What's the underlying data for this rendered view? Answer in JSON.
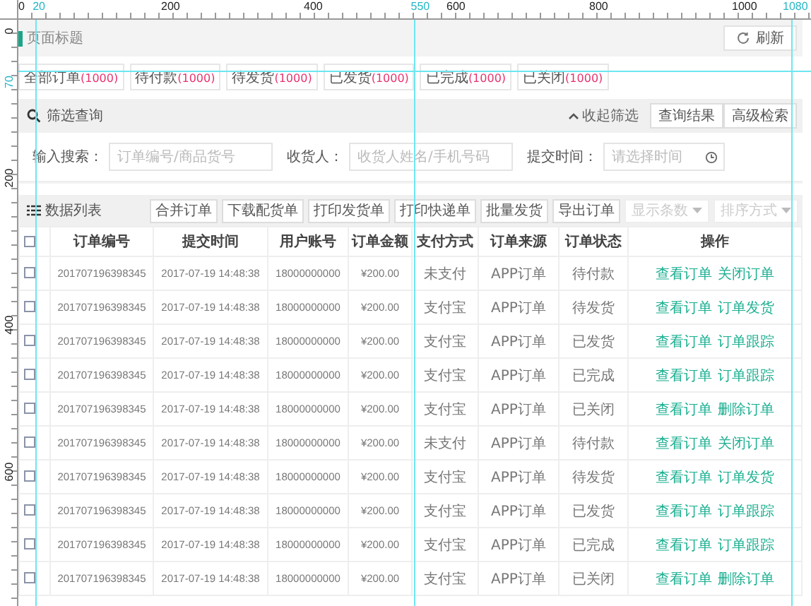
{
  "ruler": {
    "top": [
      {
        "label": "0",
        "kind": "tick"
      },
      {
        "label": "20",
        "kind": "guide"
      },
      {
        "label": "200",
        "kind": "tick"
      },
      {
        "label": "400",
        "kind": "tick"
      },
      {
        "label": "550",
        "kind": "guide"
      },
      {
        "label": "600",
        "kind": "tick"
      },
      {
        "label": "800",
        "kind": "tick"
      },
      {
        "label": "1000",
        "kind": "tick"
      },
      {
        "label": "1080",
        "kind": "guide"
      }
    ],
    "left": [
      {
        "label": "0",
        "kind": "tick"
      },
      {
        "label": "70",
        "kind": "guide"
      },
      {
        "label": "200",
        "kind": "tick"
      },
      {
        "label": "400",
        "kind": "tick"
      },
      {
        "label": "600",
        "kind": "tick"
      }
    ]
  },
  "page_header": {
    "title": "页面标题",
    "refresh_button": "刷新"
  },
  "tabs": [
    {
      "label": "全部订单",
      "count": "(1000)"
    },
    {
      "label": "待付款",
      "count": "(1000)"
    },
    {
      "label": "待发货",
      "count": "(1000)"
    },
    {
      "label": "已发货",
      "count": "(1000)"
    },
    {
      "label": "已完成",
      "count": "(1000)"
    },
    {
      "label": "已关闭",
      "count": "(1000)"
    }
  ],
  "filter": {
    "title": "筛选查询",
    "collapse": "收起筛选",
    "buttons": [
      "查询结果",
      "高级检索"
    ],
    "fields": [
      {
        "label": "输入搜索：",
        "placeholder": "订单编号/商品货号",
        "kind": "text"
      },
      {
        "label": "收货人：",
        "placeholder": "收货人姓名/手机号码",
        "kind": "text"
      },
      {
        "label": "提交时间：",
        "placeholder": "请选择时间",
        "kind": "date"
      }
    ]
  },
  "list": {
    "title": "数据列表",
    "buttons": [
      "合并订单",
      "下载配货单",
      "打印发货单",
      "打印快递单",
      "批量发货",
      "导出订单"
    ],
    "selects": [
      {
        "placeholder": "显示条数"
      },
      {
        "placeholder": "排序方式"
      }
    ]
  },
  "table": {
    "header_checked": false,
    "columns": [
      "订单编号",
      "提交时间",
      "用户账号",
      "订单金额",
      "支付方式",
      "订单来源",
      "订单状态",
      "操作"
    ],
    "rows": [
      {
        "checked": false,
        "cells": [
          "201707196398345",
          "2017-07-19 14:48:38",
          "18000000000",
          "¥200.00",
          "未支付",
          "APP订单",
          "待付款"
        ],
        "actions": [
          "查看订单",
          "关闭订单"
        ]
      },
      {
        "checked": false,
        "cells": [
          "201707196398345",
          "2017-07-19 14:48:38",
          "18000000000",
          "¥200.00",
          "支付宝",
          "APP订单",
          "待发货"
        ],
        "actions": [
          "查看订单",
          "订单发货"
        ]
      },
      {
        "checked": false,
        "cells": [
          "201707196398345",
          "2017-07-19 14:48:38",
          "18000000000",
          "¥200.00",
          "支付宝",
          "APP订单",
          "已发货"
        ],
        "actions": [
          "查看订单",
          "订单跟踪"
        ]
      },
      {
        "checked": false,
        "cells": [
          "201707196398345",
          "2017-07-19 14:48:38",
          "18000000000",
          "¥200.00",
          "支付宝",
          "APP订单",
          "已完成"
        ],
        "actions": [
          "查看订单",
          "订单跟踪"
        ]
      },
      {
        "checked": false,
        "cells": [
          "201707196398345",
          "2017-07-19 14:48:38",
          "18000000000",
          "¥200.00",
          "支付宝",
          "APP订单",
          "已关闭"
        ],
        "actions": [
          "查看订单",
          "删除订单"
        ]
      },
      {
        "checked": false,
        "cells": [
          "201707196398345",
          "2017-07-19 14:48:38",
          "18000000000",
          "¥200.00",
          "未支付",
          "APP订单",
          "待付款"
        ],
        "actions": [
          "查看订单",
          "关闭订单"
        ]
      },
      {
        "checked": false,
        "cells": [
          "201707196398345",
          "2017-07-19 14:48:38",
          "18000000000",
          "¥200.00",
          "支付宝",
          "APP订单",
          "待发货"
        ],
        "actions": [
          "查看订单",
          "订单发货"
        ]
      },
      {
        "checked": false,
        "cells": [
          "201707196398345",
          "2017-07-19 14:48:38",
          "18000000000",
          "¥200.00",
          "支付宝",
          "APP订单",
          "已发货"
        ],
        "actions": [
          "查看订单",
          "订单跟踪"
        ]
      },
      {
        "checked": false,
        "cells": [
          "201707196398345",
          "2017-07-19 14:48:38",
          "18000000000",
          "¥200.00",
          "支付宝",
          "APP订单",
          "已完成"
        ],
        "actions": [
          "查看订单",
          "订单跟踪"
        ]
      },
      {
        "checked": false,
        "cells": [
          "201707196398345",
          "2017-07-19 14:48:38",
          "18000000000",
          "¥200.00",
          "支付宝",
          "APP订单",
          "已关闭"
        ],
        "actions": [
          "查看订单",
          "删除订单"
        ]
      }
    ]
  }
}
